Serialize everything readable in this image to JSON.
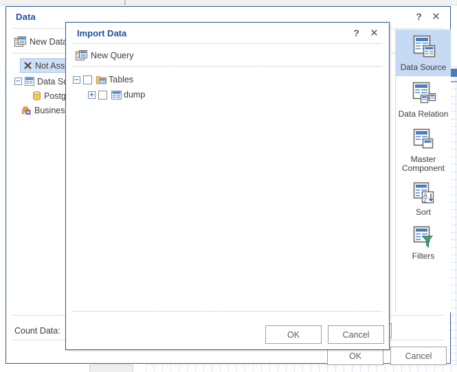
{
  "window": {
    "title": "Data",
    "help_label": "?",
    "close_label": "✕",
    "new_data_source_label": "New Data S",
    "count_data_label": "Count Data:",
    "count_data_value": "",
    "ok_label": "OK",
    "cancel_label": "Cancel"
  },
  "tree": {
    "items": [
      {
        "label": "Not Assig",
        "icon": "x-mark-icon",
        "expander": "",
        "indent": 8,
        "selected": true
      },
      {
        "label": "Data Sou",
        "icon": "table-icon",
        "expander": "−",
        "indent": 0,
        "selected": false
      },
      {
        "label": "Postgr",
        "icon": "database-icon",
        "expander": "",
        "indent": 26,
        "selected": false
      },
      {
        "label": "Business",
        "icon": "business-elements-icon",
        "expander": "",
        "indent": 10,
        "selected": false
      }
    ]
  },
  "ribbon": {
    "items": [
      {
        "label": "Data Source",
        "icon": "data-source-icon",
        "active": true
      },
      {
        "label": "Data Relation",
        "icon": "data-relation-icon",
        "active": false
      },
      {
        "label": "Master\nComponent",
        "icon": "master-component-icon",
        "active": false
      },
      {
        "label": "Sort",
        "icon": "sort-az-icon",
        "active": false
      },
      {
        "label": "Filters",
        "icon": "filter-funnel-icon",
        "active": false
      }
    ]
  },
  "dialog": {
    "title": "Import Data",
    "help_label": "?",
    "close_label": "✕",
    "new_query_label": "New Query",
    "ok_label": "OK",
    "cancel_label": "Cancel",
    "tree": [
      {
        "label": "Tables",
        "expander": "−",
        "icon": "tables-folder-icon",
        "checked": false,
        "indent": 0
      },
      {
        "label": "dump",
        "expander": "+",
        "icon": "table-grid-icon",
        "checked": false,
        "indent": 22
      }
    ]
  },
  "colors": {
    "accent_blue": "#1f4e9c",
    "border_blue": "#2c5899",
    "selection_blue": "#c6daf3",
    "icon_blue": "#4a7ebb",
    "icon_gold": "#e8b84b"
  }
}
